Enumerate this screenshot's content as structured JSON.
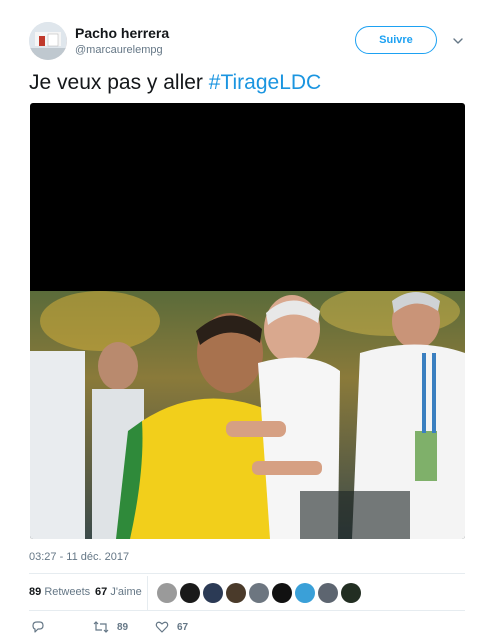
{
  "tweet": {
    "display_name": "Pacho herrera",
    "username": "@marcaurelempg",
    "follow_label": "Suivre",
    "text_before": "Je veux pas y aller ",
    "hashtag": "#TirageLDC",
    "timestamp": "03:27 - 11 déc. 2017"
  },
  "stats": {
    "retweets_count": "89",
    "retweets_label": "Retweets",
    "likes_count": "67",
    "likes_label": "J'aime",
    "liker_avatars": [
      "#9a9a9a",
      "#1a1a1a",
      "#2b3a55",
      "#4a3a2a",
      "#6d7680",
      "#111111",
      "#3aa0d8",
      "#5d6570",
      "#222e22"
    ]
  },
  "actions": {
    "reply_icon": "reply-icon",
    "retweet_icon": "retweet-icon",
    "retweet_count": "89",
    "like_icon": "heart-icon",
    "like_count": "67"
  },
  "colors": {
    "accent": "#1da1f2",
    "hashtag": "#1b95e0",
    "secondary_text": "#657786"
  }
}
